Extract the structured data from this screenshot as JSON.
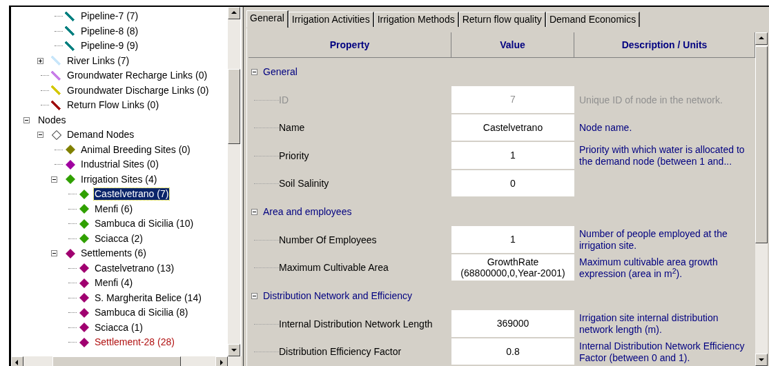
{
  "tree": [
    {
      "children": [
        {
          "children": [
            {
              "label": "Pipeline-7 (7)",
              "kind": "link",
              "color": "#008080",
              "selected": false,
              "flagged": false
            },
            {
              "label": "Pipeline-8 (8)",
              "kind": "link",
              "color": "#008080",
              "selected": false,
              "flagged": false
            },
            {
              "label": "Pipeline-9 (9)",
              "kind": "link",
              "color": "#008080",
              "selected": false,
              "flagged": false
            }
          ]
        },
        {
          "label": "River Links (7)",
          "kind": "link",
          "color": "#c8e6fa",
          "selected": false,
          "flagged": false,
          "expanded": false
        },
        {
          "label": "Groundwater Recharge Links (0)",
          "kind": "link",
          "color": "#c87ee8",
          "selected": false,
          "flagged": false
        },
        {
          "label": "Groundwater Discharge Links (0)",
          "kind": "link",
          "color": "#d4c800",
          "selected": false,
          "flagged": false
        },
        {
          "label": "Return Flow Links (0)",
          "kind": "link",
          "color": "#a01010",
          "selected": false,
          "flagged": false
        }
      ]
    },
    {
      "label": "Nodes",
      "selected": false,
      "flagged": false,
      "expanded": true,
      "children": [
        {
          "label": "Demand Nodes",
          "kind": "hollow",
          "selected": false,
          "flagged": false,
          "expanded": true,
          "children": [
            {
              "label": "Animal Breeding Sites (0)",
              "kind": "diamond",
              "color": "#808000",
              "selected": false,
              "flagged": false
            },
            {
              "label": "Industrial Sites (0)",
              "kind": "diamond",
              "color": "#a000a0",
              "selected": false,
              "flagged": false
            },
            {
              "label": "Irrigation Sites (4)",
              "kind": "diamond",
              "color": "#30a000",
              "selected": false,
              "flagged": false,
              "expanded": true,
              "children": [
                {
                  "label": "Castelvetrano (7)",
                  "kind": "diamond",
                  "color": "#30a000",
                  "selected": true,
                  "flagged": false
                },
                {
                  "label": "Menfi (6)",
                  "kind": "diamond",
                  "color": "#30a000",
                  "selected": false,
                  "flagged": false
                },
                {
                  "label": "Sambuca di Sicilia (10)",
                  "kind": "diamond",
                  "color": "#30a000",
                  "selected": false,
                  "flagged": false
                },
                {
                  "label": "Sciacca (2)",
                  "kind": "diamond",
                  "color": "#30a000",
                  "selected": false,
                  "flagged": false
                }
              ]
            },
            {
              "label": "Settlements (6)",
              "kind": "diamond",
              "color": "#a00070",
              "selected": false,
              "flagged": false,
              "expanded": true,
              "children": [
                {
                  "label": "Castelvetrano (13)",
                  "kind": "diamond",
                  "color": "#a00070",
                  "selected": false,
                  "flagged": false
                },
                {
                  "label": "Menfi (4)",
                  "kind": "diamond",
                  "color": "#a00070",
                  "selected": false,
                  "flagged": false
                },
                {
                  "label": "S. Margherita Belice (14)",
                  "kind": "diamond",
                  "color": "#a00070",
                  "selected": false,
                  "flagged": false
                },
                {
                  "label": "Sambuca di Sicilia (8)",
                  "kind": "diamond",
                  "color": "#a00070",
                  "selected": false,
                  "flagged": false
                },
                {
                  "label": "Sciacca (1)",
                  "kind": "diamond",
                  "color": "#a00070",
                  "selected": false,
                  "flagged": false
                },
                {
                  "label": "Settlement-28 (28)",
                  "kind": "diamond",
                  "color": "#a00070",
                  "selected": false,
                  "flagged": true
                }
              ]
            }
          ]
        }
      ]
    }
  ],
  "tabs": [
    {
      "label": "General",
      "selected": true
    },
    {
      "label": "Irrigation Activities",
      "selected": false
    },
    {
      "label": "Irrigation Methods",
      "selected": false
    },
    {
      "label": "Return flow quality",
      "selected": false
    },
    {
      "label": "Demand Economics",
      "selected": false
    }
  ],
  "grid": {
    "columns": [
      "Property",
      "Value",
      "Description / Units"
    ],
    "sections": [
      {
        "title": "General",
        "expanded": true,
        "rows": [
          {
            "property": "ID",
            "value": "7",
            "description": "Unique ID of node in the network.",
            "disabled": true
          },
          {
            "property": "Name",
            "value": "Castelvetrano",
            "description": "Node name.",
            "disabled": false
          },
          {
            "property": "Priority",
            "value": "1",
            "description": "Priority with which water is allocated to the demand node (between 1 and...",
            "disabled": false
          },
          {
            "property": "Soil Salinity",
            "value": "0",
            "description": "",
            "disabled": false
          }
        ]
      },
      {
        "title": "Area and employees",
        "expanded": true,
        "rows": [
          {
            "property": "Number Of Employees",
            "value": "1",
            "description": "Number of people employed at the irrigation site.",
            "disabled": false
          },
          {
            "property": "Maximum Cultivable Area",
            "value": "GrowthRate (68800000,0,Year-2001)",
            "description": "Maximum cultivable area growth expression (area in m$^{2}$).",
            "disabled": false
          }
        ]
      },
      {
        "title": "Distribution Network and Efficiency",
        "expanded": true,
        "rows": [
          {
            "property": "Internal Distribution Network Length",
            "value": "369000",
            "description": "Irrigation site internal distribution network length (m).",
            "disabled": false
          },
          {
            "property": "Distribution Efficiency Factor",
            "value": "0.8",
            "description": "Internal Distribution Network Efficiency Factor (between 0 and 1).",
            "disabled": false
          }
        ]
      }
    ]
  }
}
